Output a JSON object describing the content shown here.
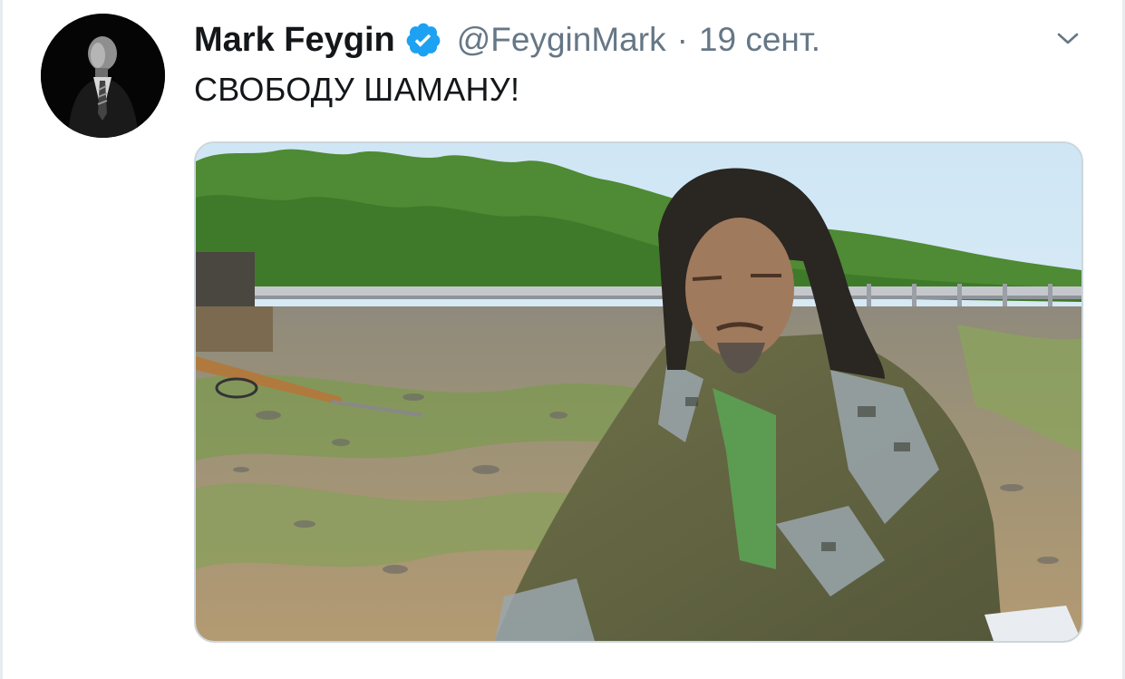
{
  "tweet": {
    "author": {
      "display_name": "Mark Feygin",
      "handle": "@FeyginMark",
      "verified": true,
      "avatar_icon": "profile-photo"
    },
    "separator": "·",
    "timestamp": "19 сент.",
    "text": "СВОБОДУ ШАМАНУ!",
    "media": {
      "type": "photo"
    }
  },
  "colors": {
    "text_primary": "#14171a",
    "text_secondary": "#657786",
    "verified_blue": "#1da1f2",
    "border": "#ccd6dd"
  },
  "icons": {
    "verified": "verified-badge-icon",
    "menu": "chevron-down-icon"
  }
}
